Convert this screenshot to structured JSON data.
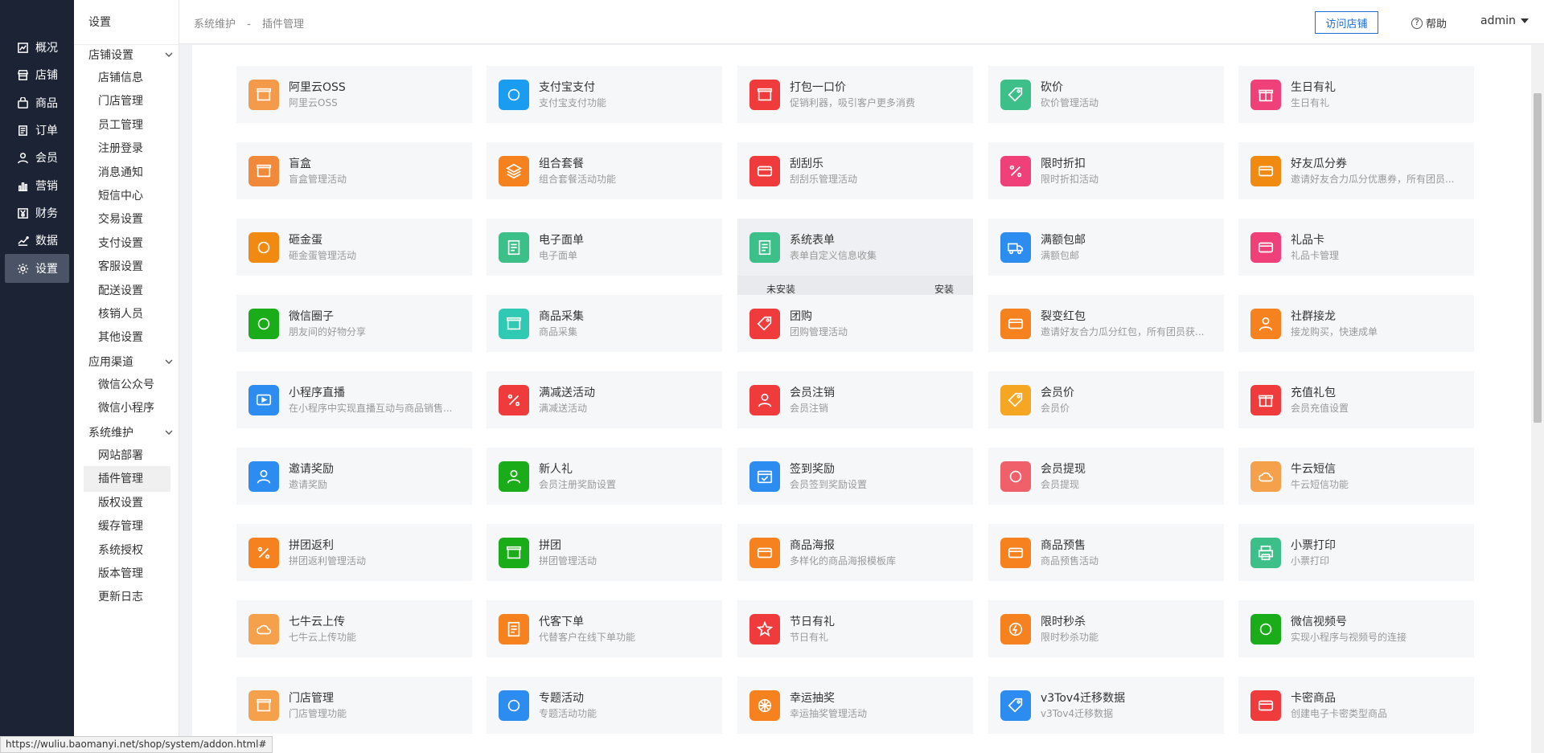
{
  "primary_nav": [
    {
      "label": "概况",
      "icon": "chart-line-icon"
    },
    {
      "label": "店铺",
      "icon": "store-icon"
    },
    {
      "label": "商品",
      "icon": "bag-icon"
    },
    {
      "label": "订单",
      "icon": "order-list-icon"
    },
    {
      "label": "会员",
      "icon": "user-icon"
    },
    {
      "label": "营销",
      "icon": "bar-chart-icon"
    },
    {
      "label": "财务",
      "icon": "yen-icon"
    },
    {
      "label": "数据",
      "icon": "data-icon"
    },
    {
      "label": "设置",
      "icon": "gear-icon"
    }
  ],
  "sub_nav": {
    "title": "设置",
    "groups": [
      {
        "label": "店铺设置",
        "items": [
          "店铺信息",
          "门店管理",
          "员工管理",
          "注册登录",
          "消息通知",
          "短信中心",
          "交易设置",
          "支付设置",
          "客服设置",
          "配送设置",
          "核销人员",
          "其他设置"
        ]
      },
      {
        "label": "应用渠道",
        "items": [
          "微信公众号",
          "微信小程序"
        ]
      },
      {
        "label": "系统维护",
        "items": [
          "网站部署",
          "插件管理",
          "版权设置",
          "缓存管理",
          "系统授权",
          "版本管理",
          "更新日志"
        ]
      }
    ],
    "active_item": "插件管理"
  },
  "header": {
    "breadcrumb": [
      "系统维护",
      "-",
      "插件管理"
    ],
    "visit_store": "访问店铺",
    "help": "帮助",
    "user": "admin"
  },
  "hover_bar": {
    "status": "未安装",
    "action": "安装"
  },
  "accent_color": "#1a6fd6",
  "plugins": [
    {
      "name": "阿里云OSS",
      "desc": "阿里云OSS",
      "color": "#f39a4b",
      "icon": "cloud-bracket-icon"
    },
    {
      "name": "支付宝支付",
      "desc": "支付宝支付功能",
      "color": "#1a9cf0",
      "icon": "alipay-icon"
    },
    {
      "name": "打包一口价",
      "desc": "促销利器，吸引客户更多消费",
      "color": "#ef3b3b",
      "icon": "box-icon"
    },
    {
      "name": "砍价",
      "desc": "砍价管理活动",
      "color": "#3dbf8a",
      "icon": "price-tag-icon"
    },
    {
      "name": "生日有礼",
      "desc": "生日有礼",
      "color": "#f0407a",
      "icon": "cake-icon"
    },
    {
      "name": "盲盒",
      "desc": "盲盒管理活动",
      "color": "#f08a3a",
      "icon": "mystery-box-icon"
    },
    {
      "name": "组合套餐",
      "desc": "组合套餐活动功能",
      "color": "#f5821f",
      "icon": "layers-icon"
    },
    {
      "name": "刮刮乐",
      "desc": "刮刮乐管理活动",
      "color": "#ef3b3b",
      "icon": "scratch-card-icon"
    },
    {
      "name": "限时折扣",
      "desc": "限时折扣活动",
      "color": "#f0407a",
      "icon": "discount-icon"
    },
    {
      "name": "好友瓜分券",
      "desc": "邀请好友合力瓜分优惠券，所有团员...",
      "color": "#f08a10",
      "icon": "coupon-icon"
    },
    {
      "name": "砸金蛋",
      "desc": "砸金蛋管理活动",
      "color": "#f08a10",
      "icon": "egg-icon"
    },
    {
      "name": "电子面单",
      "desc": "电子面单",
      "color": "#3dbf8a",
      "icon": "bookmark-icon"
    },
    {
      "name": "系统表单",
      "desc": "表单自定义信息收集",
      "color": "#3dbf8a",
      "icon": "form-icon"
    },
    {
      "name": "满额包邮",
      "desc": "满额包邮",
      "color": "#2d8cf0",
      "icon": "truck-icon"
    },
    {
      "name": "礼品卡",
      "desc": "礼品卡管理",
      "color": "#f0407a",
      "icon": "gift-card-icon"
    },
    {
      "name": "微信圈子",
      "desc": "朋友间的好物分享",
      "color": "#1aad19",
      "icon": "circle-icon"
    },
    {
      "name": "商品采集",
      "desc": "商品采集",
      "color": "#2fc9b4",
      "icon": "collect-icon"
    },
    {
      "name": "团购",
      "desc": "团购管理活动",
      "color": "#ef3b3b",
      "icon": "tags-icon"
    },
    {
      "name": "裂变红包",
      "desc": "邀请好友合力瓜分红包，所有团员获...",
      "color": "#f5821f",
      "icon": "red-packet-icon"
    },
    {
      "name": "社群接龙",
      "desc": "接龙购买，快速成单",
      "color": "#f5821f",
      "icon": "group-icon"
    },
    {
      "name": "小程序直播",
      "desc": "在小程序中实现直播互动与商品销售...",
      "color": "#2d8cf0",
      "icon": "live-tv-icon"
    },
    {
      "name": "满减送活动",
      "desc": "满减送活动",
      "color": "#ef3b3b",
      "icon": "percent-icon"
    },
    {
      "name": "会员注销",
      "desc": "会员注销",
      "color": "#ef3b3b",
      "icon": "user-cancel-icon"
    },
    {
      "name": "会员价",
      "desc": "会员价",
      "color": "#f5a623",
      "icon": "member-price-icon"
    },
    {
      "name": "充值礼包",
      "desc": "会员充值设置",
      "color": "#ef3b3b",
      "icon": "gift-icon"
    },
    {
      "name": "邀请奖励",
      "desc": "邀请奖励",
      "color": "#2d8cf0",
      "icon": "invite-icon"
    },
    {
      "name": "新人礼",
      "desc": "会员注册奖励设置",
      "color": "#1aad19",
      "icon": "new-user-icon"
    },
    {
      "name": "签到奖励",
      "desc": "会员签到奖励设置",
      "color": "#2d8cf0",
      "icon": "calendar-check-icon"
    },
    {
      "name": "会员提现",
      "desc": "会员提现",
      "color": "#f0606a",
      "icon": "withdraw-icon"
    },
    {
      "name": "牛云短信",
      "desc": "牛云短信功能",
      "color": "#f5a04b",
      "icon": "cloud-message-icon"
    },
    {
      "name": "拼团返利",
      "desc": "拼团返利管理活动",
      "color": "#f5821f",
      "icon": "rebate-icon"
    },
    {
      "name": "拼团",
      "desc": "拼团管理活动",
      "color": "#1aad19",
      "icon": "puzzle-icon"
    },
    {
      "name": "商品海报",
      "desc": "多样化的商品海报模板库",
      "color": "#f5821f",
      "icon": "poster-icon"
    },
    {
      "name": "商品预售",
      "desc": "商品预售活动",
      "color": "#f5821f",
      "icon": "presale-icon"
    },
    {
      "name": "小票打印",
      "desc": "小票打印",
      "color": "#3dbf8a",
      "icon": "printer-icon"
    },
    {
      "name": "七牛云上传",
      "desc": "七牛云上传功能",
      "color": "#f5a04b",
      "icon": "qiniu-icon"
    },
    {
      "name": "代客下单",
      "desc": "代替客户在线下单功能",
      "color": "#f5821f",
      "icon": "proxy-order-icon"
    },
    {
      "name": "节日有礼",
      "desc": "节日有礼",
      "color": "#ef3b3b",
      "icon": "star-icon"
    },
    {
      "name": "限时秒杀",
      "desc": "限时秒杀功能",
      "color": "#f5821f",
      "icon": "flash-sale-icon"
    },
    {
      "name": "微信视频号",
      "desc": "实现小程序与视频号的连接",
      "color": "#1aad19",
      "icon": "channels-icon"
    },
    {
      "name": "门店管理",
      "desc": "门店管理功能",
      "color": "#f5a04b",
      "icon": "shop-gear-icon"
    },
    {
      "name": "专题活动",
      "desc": "专题活动功能",
      "color": "#2d8cf0",
      "icon": "topic-icon"
    },
    {
      "name": "幸运抽奖",
      "desc": "幸运抽奖管理活动",
      "color": "#f5821f",
      "icon": "wheel-icon"
    },
    {
      "name": "v3Tov4迁移数据",
      "desc": "v3Tov4迁移数据",
      "color": "#2d8cf0",
      "icon": "migrate-icon"
    },
    {
      "name": "卡密商品",
      "desc": "创建电子卡密类型商品",
      "color": "#ef3b3b",
      "icon": "card-secret-icon"
    }
  ],
  "status_url": "https://wuliu.baomanyi.net/shop/system/addon.html#"
}
